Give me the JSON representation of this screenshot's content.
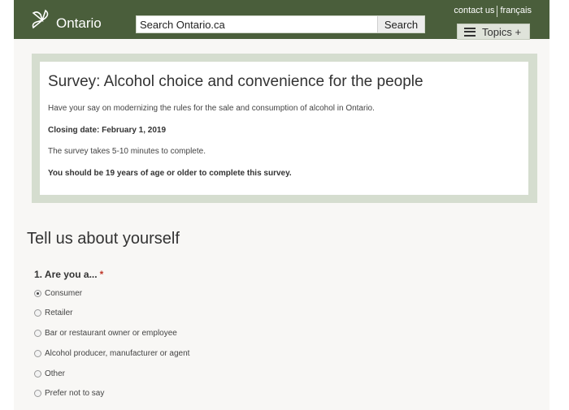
{
  "header": {
    "logo_text": "Ontario",
    "search_placeholder": "Search Ontario.ca",
    "search_button": "Search",
    "utility_links": [
      "contact us",
      "français"
    ],
    "topics_button": "Topics +"
  },
  "survey": {
    "title": "Survey: Alcohol choice and convenience for the people",
    "intro": "Have your say on modernizing the rules for the sale and consumption of alcohol in Ontario.",
    "closing_date": "Closing date: February 1, 2019",
    "duration": "The survey takes 5-10 minutes to complete.",
    "age_requirement": "You should be 19 years of age or older to complete this survey."
  },
  "form": {
    "section_heading": "Tell us about yourself",
    "question": "1. Are you a...",
    "required_marker": "*",
    "options": [
      {
        "label": "Consumer",
        "selected": true
      },
      {
        "label": "Retailer",
        "selected": false
      },
      {
        "label": "Bar or restaurant owner or employee",
        "selected": false
      },
      {
        "label": "Alcohol producer, manufacturer or agent",
        "selected": false
      },
      {
        "label": "Other",
        "selected": false
      },
      {
        "label": "Prefer not to say",
        "selected": false
      }
    ]
  },
  "colors": {
    "header_bg": "#4a5e3b",
    "survey_border": "#d5ddcf",
    "required": "#c0392b"
  },
  "icons": [
    "trillium-logo-icon",
    "hamburger-menu-icon",
    "radio-icon"
  ]
}
